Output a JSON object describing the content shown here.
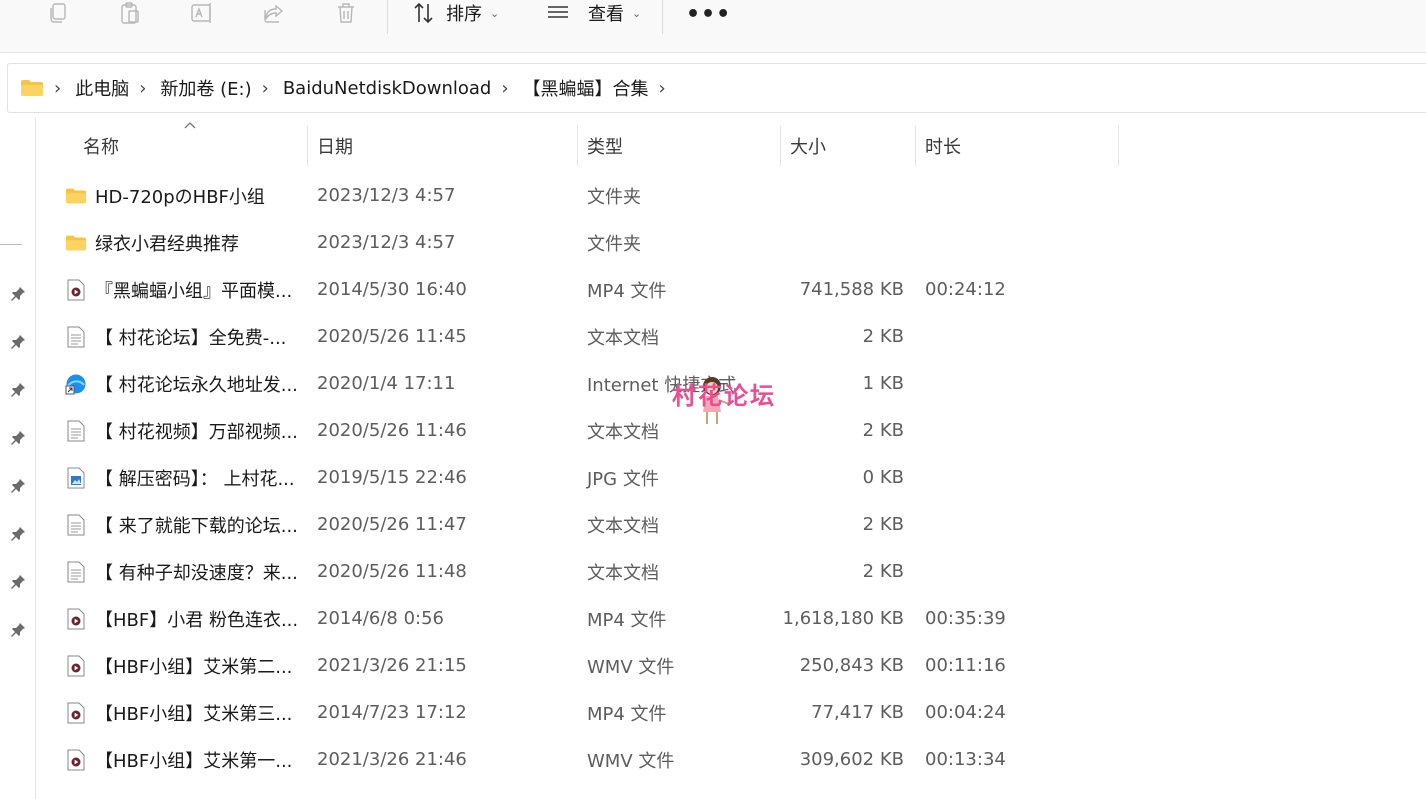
{
  "toolbar": {
    "icons": [
      "copy-icon",
      "paste-icon",
      "rename-icon",
      "share-icon",
      "delete-icon"
    ],
    "sort_label": "排序",
    "view_label": "查看",
    "more_label": "•••"
  },
  "breadcrumb": {
    "items": [
      "此电脑",
      "新加卷 (E:)",
      "BaiduNetdiskDownload",
      "【黑蝙蝠】合集"
    ],
    "separator": "›"
  },
  "columns": {
    "name": "名称",
    "date": "日期",
    "type": "类型",
    "size": "大小",
    "duration": "时长"
  },
  "rows": [
    {
      "icon": "folder-icon",
      "name": "HD-720pのHBF小组",
      "date": "2023/12/3 4:57",
      "type": "文件夹",
      "size": "",
      "duration": ""
    },
    {
      "icon": "folder-icon",
      "name": "绿衣小君经典推荐",
      "date": "2023/12/3 4:57",
      "type": "文件夹",
      "size": "",
      "duration": ""
    },
    {
      "icon": "video-file-icon",
      "name": "『黑蝙蝠小组』平面模...",
      "date": "2014/5/30 16:40",
      "type": "MP4 文件",
      "size": "741,588 KB",
      "duration": "00:24:12"
    },
    {
      "icon": "text-file-icon",
      "name": "【 村花论坛】全免费-...",
      "date": "2020/5/26 11:45",
      "type": "文本文档",
      "size": "2 KB",
      "duration": ""
    },
    {
      "icon": "internet-shortcut-icon",
      "name": "【 村花论坛永久地址发...",
      "date": "2020/1/4 17:11",
      "type": "Internet 快捷方式",
      "size": "1 KB",
      "duration": ""
    },
    {
      "icon": "text-file-icon",
      "name": "【 村花视频】万部视频...",
      "date": "2020/5/26 11:46",
      "type": "文本文档",
      "size": "2 KB",
      "duration": ""
    },
    {
      "icon": "image-file-icon",
      "name": "【 解压密码】： 上村花...",
      "date": "2019/5/15 22:46",
      "type": "JPG 文件",
      "size": "0 KB",
      "duration": ""
    },
    {
      "icon": "text-file-icon",
      "name": "【 来了就能下载的论坛...",
      "date": "2020/5/26 11:47",
      "type": "文本文档",
      "size": "2 KB",
      "duration": ""
    },
    {
      "icon": "text-file-icon",
      "name": "【 有种子却没速度？来...",
      "date": "2020/5/26 11:48",
      "type": "文本文档",
      "size": "2 KB",
      "duration": ""
    },
    {
      "icon": "video-file-icon",
      "name": "【HBF】小君 粉色连衣...",
      "date": "2014/6/8 0:56",
      "type": "MP4 文件",
      "size": "1,618,180 KB",
      "duration": "00:35:39"
    },
    {
      "icon": "video-file-icon",
      "name": "【HBF小组】艾米第二...",
      "date": "2021/3/26 21:15",
      "type": "WMV 文件",
      "size": "250,843 KB",
      "duration": "00:11:16"
    },
    {
      "icon": "video-file-icon",
      "name": "【HBF小组】艾米第三...",
      "date": "2014/7/23 17:12",
      "type": "MP4 文件",
      "size": "77,417 KB",
      "duration": "00:04:24"
    },
    {
      "icon": "video-file-icon",
      "name": "【HBF小组】艾米第一...",
      "date": "2021/3/26 21:46",
      "type": "WMV 文件",
      "size": "309,602 KB",
      "duration": "00:13:34"
    }
  ],
  "watermark": {
    "text": "村花论坛"
  },
  "colors": {
    "folder": "#f8c543",
    "watermark": "#ea4d94",
    "video_badge": "#6b2233"
  }
}
